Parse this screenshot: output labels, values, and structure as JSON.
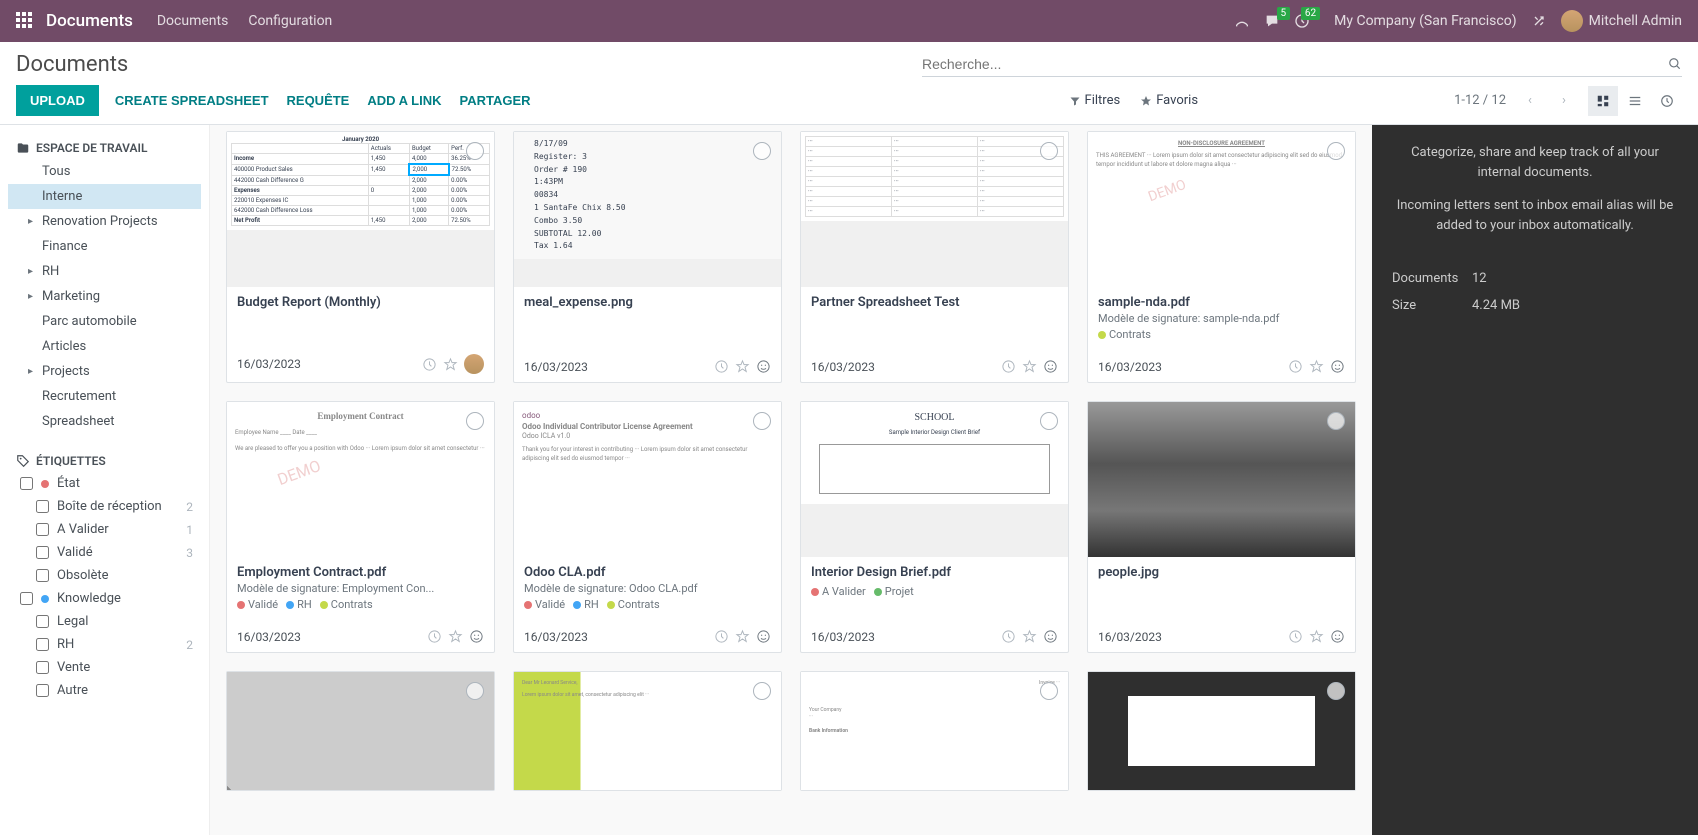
{
  "navbar": {
    "brand": "Documents",
    "links": [
      "Documents",
      "Configuration"
    ],
    "messages_badge": "5",
    "activities_badge": "62",
    "company": "My Company (San Francisco)",
    "user": "Mitchell Admin"
  },
  "control": {
    "title": "Documents",
    "search_placeholder": "Recherche...",
    "upload": "UPLOAD",
    "create_spreadsheet": "CREATE SPREADSHEET",
    "requete": "REQUÊTE",
    "add_link": "ADD A LINK",
    "partager": "PARTAGER",
    "filtres": "Filtres",
    "favoris": "Favoris",
    "pager": "1-12 / 12"
  },
  "sidebar": {
    "workspace_header": "ESPACE DE TRAVAIL",
    "workspaces": [
      {
        "label": "Tous",
        "caret": false,
        "active": false
      },
      {
        "label": "Interne",
        "caret": false,
        "active": true
      },
      {
        "label": "Renovation Projects",
        "caret": true,
        "active": false
      },
      {
        "label": "Finance",
        "caret": false,
        "active": false
      },
      {
        "label": "RH",
        "caret": true,
        "active": false
      },
      {
        "label": "Marketing",
        "caret": true,
        "active": false
      },
      {
        "label": "Parc automobile",
        "caret": false,
        "active": false
      },
      {
        "label": "Articles",
        "caret": false,
        "active": false
      },
      {
        "label": "Projects",
        "caret": true,
        "active": false
      },
      {
        "label": "Recrutement",
        "caret": false,
        "active": false
      },
      {
        "label": "Spreadsheet",
        "caret": false,
        "active": false
      }
    ],
    "tags_header": "ÉTIQUETTES",
    "tag_groups": [
      {
        "label": "État",
        "dot": "#E57373",
        "items": [
          {
            "label": "Boîte de réception",
            "count": "2"
          },
          {
            "label": "A Valider",
            "count": "1"
          },
          {
            "label": "Validé",
            "count": "3"
          },
          {
            "label": "Obsolète",
            "count": ""
          }
        ]
      },
      {
        "label": "Knowledge",
        "dot": "#42A5F5",
        "items": [
          {
            "label": "Legal",
            "count": ""
          },
          {
            "label": "RH",
            "count": "2"
          },
          {
            "label": "Vente",
            "count": ""
          },
          {
            "label": "Autre",
            "count": ""
          }
        ]
      }
    ]
  },
  "docs": [
    {
      "title": "Budget Report (Monthly)",
      "date": "16/03/2023",
      "sub": "",
      "tags": [],
      "avatar": true,
      "thumb": "spread"
    },
    {
      "title": "meal_expense.png",
      "date": "16/03/2023",
      "sub": "",
      "tags": [],
      "avatar": false,
      "thumb": "receipt"
    },
    {
      "title": "Partner Spreadsheet Test",
      "date": "16/03/2023",
      "sub": "",
      "tags": [],
      "avatar": false,
      "thumb": "spread2"
    },
    {
      "title": "sample-nda.pdf",
      "date": "16/03/2023",
      "sub": "Modèle de signature: sample-nda.pdf",
      "tags": [
        {
          "dot": "#C4D94A",
          "label": "Contrats"
        }
      ],
      "avatar": false,
      "thumb": "nda"
    },
    {
      "title": "Employment Contract.pdf",
      "date": "16/03/2023",
      "sub": "Modèle de signature: Employment Con...",
      "tags": [
        {
          "dot": "#E57373",
          "label": "Validé"
        },
        {
          "dot": "#42A5F5",
          "label": "RH"
        },
        {
          "dot": "#C4D94A",
          "label": "Contrats"
        }
      ],
      "avatar": false,
      "thumb": "contract"
    },
    {
      "title": "Odoo CLA.pdf",
      "date": "16/03/2023",
      "sub": "Modèle de signature: Odoo CLA.pdf",
      "tags": [
        {
          "dot": "#E57373",
          "label": "Validé"
        },
        {
          "dot": "#42A5F5",
          "label": "RH"
        },
        {
          "dot": "#C4D94A",
          "label": "Contrats"
        }
      ],
      "avatar": false,
      "thumb": "cla"
    },
    {
      "title": "Interior Design Brief.pdf",
      "date": "16/03/2023",
      "sub": "",
      "tags": [
        {
          "dot": "#E57373",
          "label": "A Valider"
        },
        {
          "dot": "#66BB6A",
          "label": "Projet"
        }
      ],
      "avatar": false,
      "thumb": "brief"
    },
    {
      "title": "people.jpg",
      "date": "16/03/2023",
      "sub": "",
      "tags": [],
      "avatar": false,
      "thumb": "photo"
    }
  ],
  "partial_docs": [
    {
      "thumb": "building"
    },
    {
      "thumb": "green"
    },
    {
      "thumb": "invoice"
    },
    {
      "thumb": "odoo"
    }
  ],
  "info": {
    "line1": "Categorize, share and keep track of all your internal documents.",
    "line2": "Incoming letters sent to inbox email alias will be added to your inbox automatically.",
    "stat_docs_label": "Documents",
    "stat_docs_value": "12",
    "stat_size_label": "Size",
    "stat_size_value": "4.24 MB"
  },
  "thumbs": {
    "receipt_lines": [
      "8/17/09",
      "Register: 3",
      "Order # 190",
      "1:43PM",
      "00834",
      "1 SantaFe Chix    8.50",
      "   Combo          3.50",
      "   SUBTOTAL      12.00",
      "   Tax            1.64"
    ],
    "cla_head": "Odoo Individual Contributor License Agreement",
    "cla_sub": "Odoo ICLA v1.0",
    "contract_head": "Employment Contract",
    "nda_head": "NON-DISCLOSURE AGREEMENT",
    "brief_logo": "SCHOOL",
    "brief_sub": "Sample Interior Design Client Brief"
  }
}
